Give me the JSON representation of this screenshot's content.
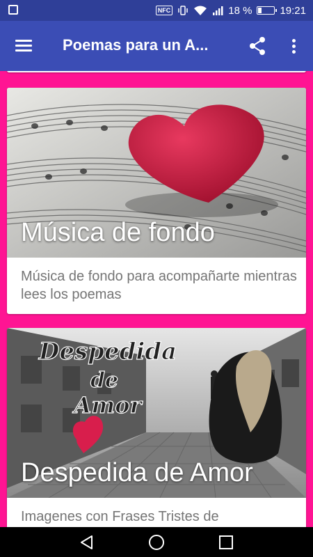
{
  "status_bar": {
    "nfc_label": "NFC",
    "battery_text": "18 %",
    "battery_level": 0.18,
    "time": "19:21"
  },
  "app_bar": {
    "title": "Poemas para un A...",
    "menu_icon": "hamburger-menu-icon",
    "share_icon": "share-icon",
    "more_icon": "more-vert-icon"
  },
  "cards": [
    {
      "title": "Música de fondo",
      "description": "Música de fondo para acompañarte mientras lees los poemas"
    },
    {
      "title": "Despedida de Amor",
      "description": "Imagenes con Frases Tristes de",
      "image_text": [
        "Despedida",
        "de",
        "Amor"
      ]
    }
  ],
  "nav_bar": {
    "back_icon": "back-triangle-icon",
    "home_icon": "home-circle-icon",
    "recents_icon": "recents-square-icon"
  },
  "colors": {
    "status_bar": "#2f3f98",
    "app_bar": "#3b4db5",
    "background": "#ff1493",
    "heart": "#d81e4c"
  }
}
